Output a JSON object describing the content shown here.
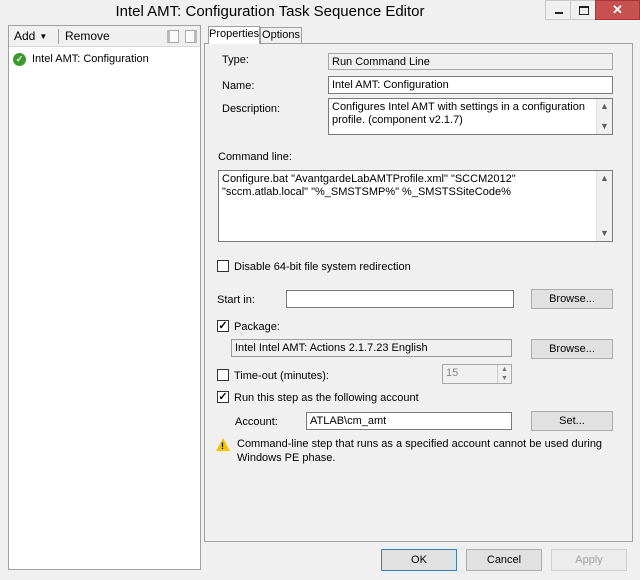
{
  "window": {
    "title": "Intel AMT: Configuration Task Sequence Editor",
    "close_glyph": "✕"
  },
  "toolbar": {
    "add_label": "Add",
    "add_caret": "▼",
    "remove_label": "Remove"
  },
  "tree": {
    "items": [
      {
        "label": "Intel AMT: Configuration",
        "icon": "green-check-icon"
      }
    ]
  },
  "tabs": [
    {
      "label": "Properties"
    },
    {
      "label": "Options"
    }
  ],
  "properties": {
    "type_label": "Type:",
    "type_value": "Run Command Line",
    "name_label": "Name:",
    "name_value": "Intel AMT: Configuration",
    "description_label": "Description:",
    "description_value": "Configures Intel AMT with settings in a configuration profile. (component v2.1.7)",
    "command_line_label": "Command line:",
    "command_line_value": "Configure.bat \"AvantgardeLabAMTProfile.xml\" \"SCCM2012\" \"sccm.atlab.local\" \"%_SMSTSMP%\" %_SMSTSSiteCode%",
    "disable_64bit_label": "Disable 64-bit file system redirection",
    "disable_64bit_checked": false,
    "start_in_label": "Start in:",
    "start_in_value": "",
    "browse_label": "Browse...",
    "package_label": "Package:",
    "package_checked": true,
    "package_value": "Intel Intel AMT: Actions 2.1.7.23 English",
    "timeout_label": "Time-out (minutes):",
    "timeout_checked": false,
    "timeout_value": "15",
    "run_as_label": "Run this step as the following account",
    "run_as_checked": true,
    "account_label": "Account:",
    "account_value": "ATLAB\\cm_amt",
    "set_label": "Set...",
    "warning_text": "Command-line step that runs as a specified account cannot be used during Windows PE phase."
  },
  "dialog": {
    "ok_label": "OK",
    "cancel_label": "Cancel",
    "apply_label": "Apply"
  },
  "glyphs": {
    "check": "✓",
    "up": "▲",
    "down": "▼",
    "warn": "!"
  }
}
